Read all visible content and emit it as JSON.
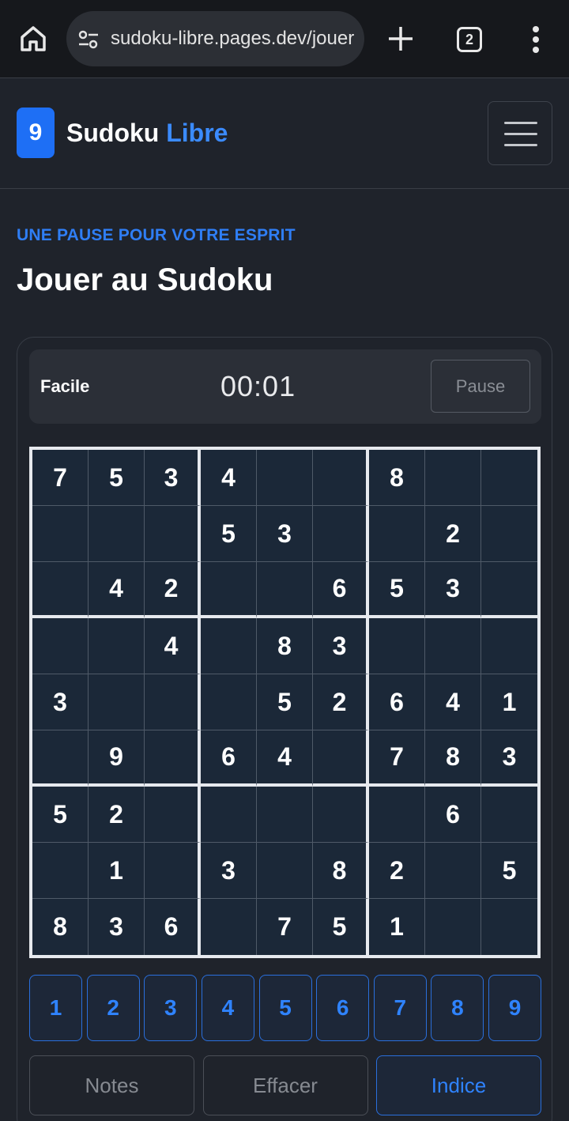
{
  "browser": {
    "url": "sudoku-libre.pages.dev/jouer",
    "tab_count": "2"
  },
  "site": {
    "logo_digit": "9",
    "brand_part1": "Sudoku",
    "brand_part2": "Libre"
  },
  "page": {
    "eyebrow": "UNE PAUSE POUR VOTRE ESPRIT",
    "title": "Jouer au Sudoku"
  },
  "game": {
    "difficulty": "Facile",
    "timer": "00:01",
    "pause_label": "Pause",
    "board": [
      [
        "7",
        "5",
        "3",
        "4",
        "",
        "",
        "8",
        "",
        ""
      ],
      [
        "",
        "",
        "",
        "5",
        "3",
        "",
        "",
        "2",
        ""
      ],
      [
        "",
        "4",
        "2",
        "",
        "",
        "6",
        "5",
        "3",
        ""
      ],
      [
        "",
        "",
        "4",
        "",
        "8",
        "3",
        "",
        "",
        ""
      ],
      [
        "3",
        "",
        "",
        "",
        "5",
        "2",
        "6",
        "4",
        "1"
      ],
      [
        "",
        "9",
        "",
        "6",
        "4",
        "",
        "7",
        "8",
        "3"
      ],
      [
        "5",
        "2",
        "",
        "",
        "",
        "",
        "",
        "6",
        ""
      ],
      [
        "",
        "1",
        "",
        "3",
        "",
        "8",
        "2",
        "",
        "5"
      ],
      [
        "8",
        "3",
        "6",
        "",
        "7",
        "5",
        "1",
        "",
        ""
      ]
    ],
    "numbers": [
      "1",
      "2",
      "3",
      "4",
      "5",
      "6",
      "7",
      "8",
      "9"
    ],
    "notes_label": "Notes",
    "erase_label": "Effacer",
    "hint_label": "Indice"
  },
  "colors": {
    "accent": "#2f83ff",
    "background": "#1f232b",
    "board_bg": "#1b2838"
  }
}
